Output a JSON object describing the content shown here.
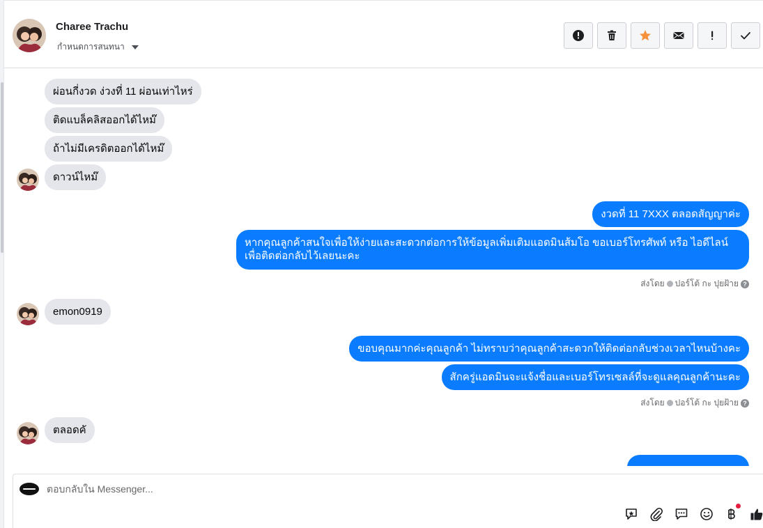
{
  "header": {
    "name": "Charee Trachu",
    "assign_label": "กำหนดการสนทนา",
    "actions": [
      {
        "name": "spam-button",
        "icon": "alert-circle-icon"
      },
      {
        "name": "delete-button",
        "icon": "trash-icon"
      },
      {
        "name": "star-button",
        "icon": "star-icon"
      },
      {
        "name": "mark-unread-button",
        "icon": "envelope-icon"
      },
      {
        "name": "follow-up-button",
        "icon": "exclamation-icon"
      },
      {
        "name": "mark-done-button",
        "icon": "checkmark-icon"
      }
    ]
  },
  "thread": {
    "incoming_group_1": [
      "ผ่อนกี่งวด ง่วงที่ 11 ผ่อนเท่าไหร่",
      "ติดแบล็คลิสออกได้ไหม๊",
      "ถ้าไม่มีเครดิตออกได้ไหม๊",
      "ดาวน์ไหม๊"
    ],
    "outgoing_group_1": [
      "งวดที่ 11 7XXX  ตลอดสัญญาค่ะ",
      "หากคุณลูกค้าสนใจเพื่อให้ง่ายและสะดวกต่อการให้ข้อมูลเพิ่มเติมแอดมินส้มโอ ขอเบอร์โทรศัพท์ หรือ ไอดีไลน์ เพื่อติดต่อกลับไว้เลยนะคะ"
    ],
    "sent_by_1": {
      "prefix": "ส่งโดย",
      "agent": "ปอร์โต้ กะ ปุยฝ้าย"
    },
    "incoming_group_2": [
      "emon0919"
    ],
    "outgoing_group_2": [
      "ขอบคุณมากค่ะคุณลูกค้า ไม่ทราบว่าคุณลูกค้าสะดวกให้ติดต่อกลับช่วงเวลาไหนบ้างคะ",
      "สักครู่แอดมินจะแจ้งชื่อและเบอร์โทรเซลล์ที่จะดูแลคุณลูกค้านะคะ"
    ],
    "sent_by_2": {
      "prefix": "ส่งโดย",
      "agent": "ปอร์โต้ กะ ปุยฝ้าย"
    },
    "incoming_group_3": [
      "ตลอดคั"
    ]
  },
  "composer": {
    "placeholder": "ตอบกลับใน Messenger...",
    "tools": [
      "saved-reply-icon",
      "paperclip-icon",
      "chat-bubble-icon",
      "emoji-icon",
      "baht-icon",
      "thumbs-up-icon"
    ]
  },
  "colors": {
    "outgoing_bubble": "#0a7cff",
    "incoming_bubble": "#e4e6eb",
    "star": "#f7923b"
  }
}
